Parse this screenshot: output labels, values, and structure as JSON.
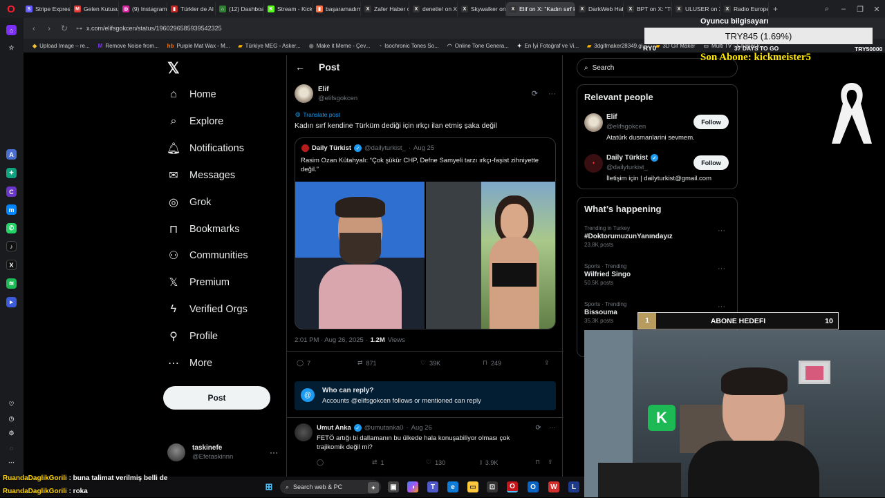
{
  "browser": {
    "tabs": [
      {
        "label": "Stripe Express",
        "color": "#635bff",
        "icon_text": "S"
      },
      {
        "label": "Gelen Kutusu",
        "color": "#e53935",
        "icon_text": "M"
      },
      {
        "label": "(9) Instagram",
        "color": "#d6249f",
        "icon_text": "◎"
      },
      {
        "label": "Türkler de Al",
        "color": "#c62828",
        "icon_text": "▮"
      },
      {
        "label": "(12) Dashboa",
        "color": "#2e7d32",
        "icon_text": "⌂"
      },
      {
        "label": "Stream - Kick",
        "color": "#53fc18",
        "icon_text": "K"
      },
      {
        "label": "başaramadım",
        "color": "#ff7043",
        "icon_text": "▮"
      },
      {
        "label": "Zafer Haber o",
        "color": "#333333",
        "icon_text": "X"
      },
      {
        "label": "denetle! on X:",
        "color": "#333333",
        "icon_text": "X"
      },
      {
        "label": "Skywalker on",
        "color": "#333333",
        "icon_text": "X"
      },
      {
        "label": "Elif on X: \"Kadın sırf ke",
        "color": "#333333",
        "icon_text": "X",
        "active": true
      },
      {
        "label": "DarkWeb Hab",
        "color": "#333333",
        "icon_text": "X"
      },
      {
        "label": "BPT on X: \"Tü",
        "color": "#333333",
        "icon_text": "X"
      },
      {
        "label": "ULUSER on X:",
        "color": "#333333",
        "icon_text": "X"
      },
      {
        "label": "Radio Europe",
        "color": "#333333",
        "icon_text": "X"
      }
    ],
    "url": "x.com/elifsgokcen/status/1960296585939542325",
    "bookmarks": [
      {
        "label": "Upload Image – re..."
      },
      {
        "label": "Remove Noise from..."
      },
      {
        "label": "Purple Mat Wax - M..."
      },
      {
        "label": "Türkiye MEG - Asker..."
      },
      {
        "label": "Make it Meme - Çev..."
      },
      {
        "label": "Isochronic Tones So..."
      },
      {
        "label": "Online Tone Genera..."
      },
      {
        "label": "En İyi Fotoğraf ve Vi..."
      },
      {
        "label": "3dgifmaker28349.gi..."
      },
      {
        "label": "3D Gif Maker"
      },
      {
        "label": "Multi TV - 5 haber k..."
      }
    ]
  },
  "nav": {
    "items": [
      {
        "label": "Home",
        "icon": "home-icon"
      },
      {
        "label": "Explore",
        "icon": "search-icon"
      },
      {
        "label": "Notifications",
        "icon": "bell-icon"
      },
      {
        "label": "Messages",
        "icon": "envelope-icon"
      },
      {
        "label": "Grok",
        "icon": "grok-icon"
      },
      {
        "label": "Bookmarks",
        "icon": "bookmark-icon"
      },
      {
        "label": "Communities",
        "icon": "people-icon"
      },
      {
        "label": "Premium",
        "icon": "x-logo-icon"
      },
      {
        "label": "Verified Orgs",
        "icon": "lightning-icon"
      },
      {
        "label": "Profile",
        "icon": "person-icon"
      },
      {
        "label": "More",
        "icon": "more-circle-icon"
      }
    ],
    "post_label": "Post",
    "account": {
      "name": "taskinefe",
      "handle": "@Efetaskinnn"
    }
  },
  "post": {
    "header_title": "Post",
    "author": {
      "name": "Elif",
      "handle": "@elifsgokcen"
    },
    "translate_label": "Translate post",
    "text": "Kadın sırf kendine Türküm dediği için ırkçı ilan etmiş şaka değil",
    "quote": {
      "author": "Daily Türkist",
      "handle": "@dailyturkist_",
      "date": "Aug 25",
      "text": "Rasim Ozan Kütahyalı: “Çok şükür CHP, Defne Samyeli tarzı ırkçı-faşist zihniyette değil.”"
    },
    "time": "2:01 PM · Aug 26, 2025 ·",
    "views_count": "1.2M",
    "views_label": "Views",
    "stats": {
      "replies": "7",
      "reposts": "871",
      "likes": "39K",
      "bookmarks": "249"
    },
    "reply_notice": {
      "title": "Who can reply?",
      "text": "Accounts @elifsgokcen follows or mentioned can reply"
    }
  },
  "reply": {
    "author": "Umut Anka",
    "handle": "@umutanka0",
    "date": "Aug 26",
    "text": "FETÖ artığı bi dallamanın bu ülkede hala konuşabiliyor  olması çok trajikomik değil mi?",
    "stats": {
      "reposts": "1",
      "likes": "130",
      "views": "3.9K"
    }
  },
  "sidebar": {
    "search_placeholder": "Search",
    "relevant_title": "Relevant people",
    "people": [
      {
        "name": "Elif",
        "handle": "@elifsgokcen",
        "bio": "Atatürk dusmanlarini sevmem.",
        "follow_label": "Follow"
      },
      {
        "name": "Daily Türkist",
        "handle": "@dailyturkist_",
        "bio": "İletişim için | dailyturkist@gmail.com",
        "follow_label": "Follow"
      }
    ],
    "happening_title": "What’s happening",
    "trends": [
      {
        "context": "Trending in Turkey",
        "name": "#DoktorumuzunYanındayız",
        "posts": "23.8K posts"
      },
      {
        "context": "Sports · Trending",
        "name": "Wilfried Singo",
        "posts": "50.5K posts"
      },
      {
        "context": "Sports · Trending",
        "name": "Bissouma",
        "posts": "35.3K posts"
      }
    ]
  },
  "stream": {
    "computer_label": "Oyuncu bilgisayarı",
    "goal_amount": "TRY845 (1.69%)",
    "goal_left": "RY0",
    "goal_days": "37 DAYS TO GO",
    "goal_right": "TRY50000",
    "last_sub": "Son Abone: kickmeister5",
    "sub_goal": {
      "current": "1",
      "label": "ABONE HEDEFI",
      "target": "10"
    },
    "chat": [
      {
        "user": "RuandaDaglikGorili",
        "message": " : buna talimat verilmiş belli de"
      },
      {
        "user": "RuandaDaglikGorili",
        "message": " : roka"
      }
    ]
  },
  "taskbar": {
    "search_label": "Search web & PC"
  }
}
